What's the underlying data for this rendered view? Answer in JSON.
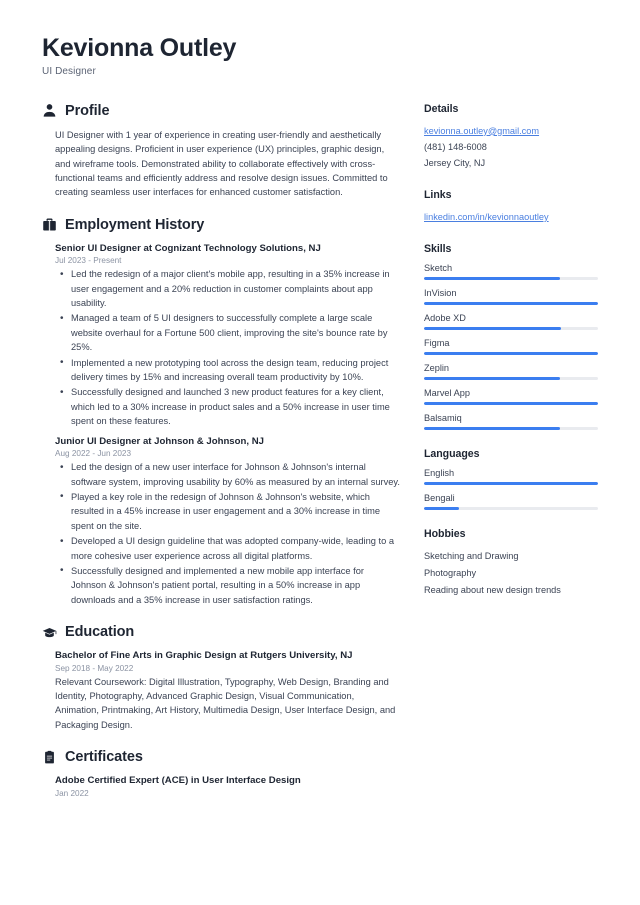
{
  "header": {
    "full_name": "Kevionna Outley",
    "job_title": "UI Designer"
  },
  "main": {
    "profile": {
      "icon": "person-icon",
      "title": "Profile",
      "text": "UI Designer with 1 year of experience in creating user-friendly and aesthetically appealing designs. Proficient in user experience (UX) principles, graphic design, and wireframe tools. Demonstrated ability to collaborate effectively with cross-functional teams and efficiently address and resolve design issues. Committed to creating seamless user interfaces for enhanced customer satisfaction."
    },
    "employment": {
      "icon": "briefcase-icon",
      "title": "Employment History",
      "entries": [
        {
          "title": "Senior UI Designer at Cognizant Technology Solutions, NJ",
          "date": "Jul 2023 - Present",
          "bullets": [
            "Led the redesign of a major client's mobile app, resulting in a 35% increase in user engagement and a 20% reduction in customer complaints about app usability.",
            "Managed a team of 5 UI designers to successfully complete a large scale website overhaul for a Fortune 500 client, improving the site's bounce rate by 25%.",
            "Implemented a new prototyping tool across the design team, reducing project delivery times by 15% and increasing overall team productivity by 10%.",
            "Successfully designed and launched 3 new product features for a key client, which led to a 30% increase in product sales and a 50% increase in user time spent on these features."
          ]
        },
        {
          "title": "Junior UI Designer at Johnson & Johnson, NJ",
          "date": "Aug 2022 - Jun 2023",
          "bullets": [
            "Led the design of a new user interface for Johnson & Johnson's internal software system, improving usability by 60% as measured by an internal survey.",
            "Played a key role in the redesign of Johnson & Johnson's website, which resulted in a 45% increase in user engagement and a 30% increase in time spent on the site.",
            "Developed a UI design guideline that was adopted company-wide, leading to a more cohesive user experience across all digital platforms.",
            "Successfully designed and implemented a new mobile app interface for Johnson & Johnson's patient portal, resulting in a 50% increase in app downloads and a 35% increase in user satisfaction ratings."
          ]
        }
      ]
    },
    "education": {
      "icon": "graduation-cap-icon",
      "title": "Education",
      "entries": [
        {
          "title": "Bachelor of Fine Arts in Graphic Design at Rutgers University, NJ",
          "date": "Sep 2018 - May 2022",
          "description": "Relevant Coursework: Digital Illustration, Typography, Web Design, Branding and Identity, Photography, Advanced Graphic Design, Visual Communication, Animation, Printmaking, Art History, Multimedia Design, User Interface Design, and Packaging Design."
        }
      ]
    },
    "certificates": {
      "icon": "certificate-icon",
      "title": "Certificates",
      "entries": [
        {
          "title": "Adobe Certified Expert (ACE) in User Interface Design",
          "date": "Jan 2022"
        }
      ]
    }
  },
  "sidebar": {
    "details": {
      "title": "Details",
      "email": "kevionna.outley@gmail.com",
      "phone": "(481) 148-6008",
      "location": "Jersey City, NJ"
    },
    "links": {
      "title": "Links",
      "items": [
        {
          "label": "linkedin.com/in/kevionnaoutley"
        }
      ]
    },
    "skills": {
      "title": "Skills",
      "items": [
        {
          "name": "Sketch",
          "level": 78
        },
        {
          "name": "InVision",
          "level": 100
        },
        {
          "name": "Adobe XD",
          "level": 79
        },
        {
          "name": "Figma",
          "level": 100
        },
        {
          "name": "Zeplin",
          "level": 78
        },
        {
          "name": "Marvel App",
          "level": 100
        },
        {
          "name": "Balsamiq",
          "level": 78
        }
      ]
    },
    "languages": {
      "title": "Languages",
      "items": [
        {
          "name": "English",
          "level": 100
        },
        {
          "name": "Bengali",
          "level": 20
        }
      ]
    },
    "hobbies": {
      "title": "Hobbies",
      "items": [
        {
          "label": "Sketching and Drawing"
        },
        {
          "label": "Photography"
        },
        {
          "label": "Reading about new design trends"
        }
      ]
    }
  },
  "theme": {
    "accent": "#3b7ef0",
    "link": "#4a7fe0",
    "heading": "#1e2532",
    "text": "#3b4354",
    "muted": "#8b93a3",
    "track": "#e9ebef"
  }
}
